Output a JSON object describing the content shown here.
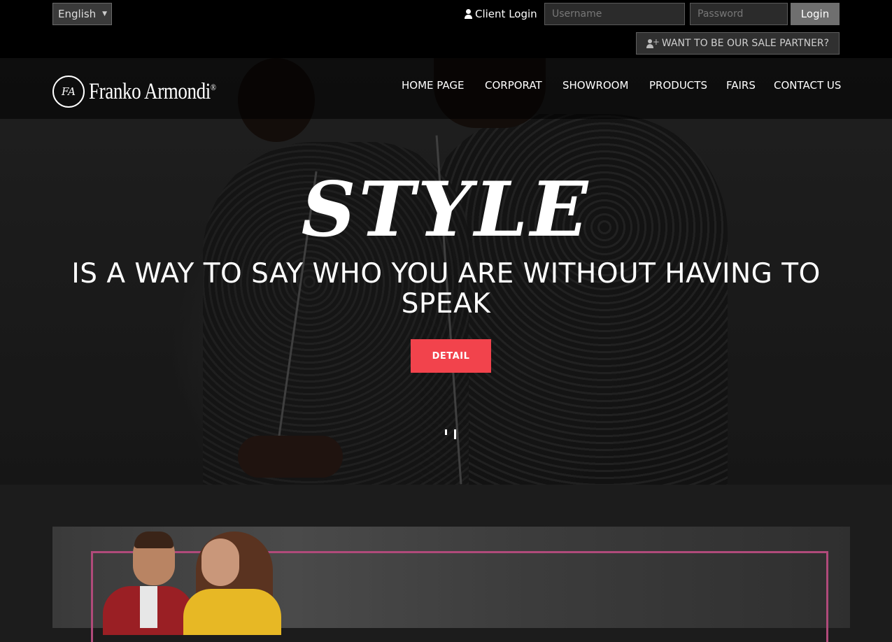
{
  "topbar": {
    "language": "English",
    "client_login": "Client Login",
    "username_placeholder": "Username",
    "password_placeholder": "Password",
    "login_label": "Login",
    "partner_label": "WANT TO BE OUR SALE PARTNER?"
  },
  "brand": {
    "name": "Franko Armondi",
    "reg": "®",
    "monogram": "FA"
  },
  "nav": {
    "items": [
      "HOME PAGE",
      "CORPORAT",
      "SHOWROOM",
      "PRODUCTS",
      "FAIRS",
      "CONTACT US"
    ]
  },
  "hero": {
    "headline": "STYLE",
    "tagline": "IS A WAY TO SAY WHO YOU ARE WITHOUT HAVING TO SPEAK",
    "button": "DETAIL"
  },
  "colors": {
    "accent": "#f2434c",
    "frame": "#b04a7a",
    "topbar": "#000000"
  }
}
